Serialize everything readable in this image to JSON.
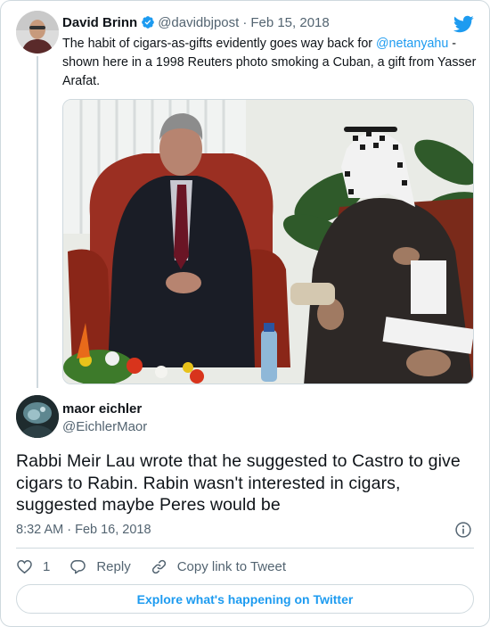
{
  "quoted_tweet": {
    "author_name": "David Brinn",
    "author_handle": "@davidbjpost",
    "separator": "·",
    "date": "Feb 15, 2018",
    "text_before_mention": "The habit of cigars-as-gifts evidently goes way back for ",
    "mention": "@netanyahu",
    "text_after_mention": " - shown here in a 1998 Reuters photo smoking a Cuban, a gift from Yasser Arafat.",
    "verified": true
  },
  "tweet": {
    "author_name": "maor eichler",
    "author_handle": "@EichlerMaor",
    "text": "Rabbi Meir Lau wrote that he suggested to Castro to give cigars to Rabin. Rabin wasn't interested in cigars, suggested maybe Peres would be",
    "timestamp": "8:32 AM · Feb 16, 2018"
  },
  "actions": {
    "like_count": "1",
    "reply_label": "Reply",
    "copy_link_label": "Copy link to Tweet"
  },
  "footer": {
    "explore_label": "Explore what's happening on Twitter"
  },
  "colors": {
    "accent": "#1d9bf0",
    "text": "#0f1419",
    "secondary": "#536471",
    "border": "#cfd9de"
  },
  "icons": [
    "verified-badge-icon",
    "twitter-bird-icon",
    "info-icon",
    "heart-icon",
    "reply-icon",
    "link-icon"
  ]
}
